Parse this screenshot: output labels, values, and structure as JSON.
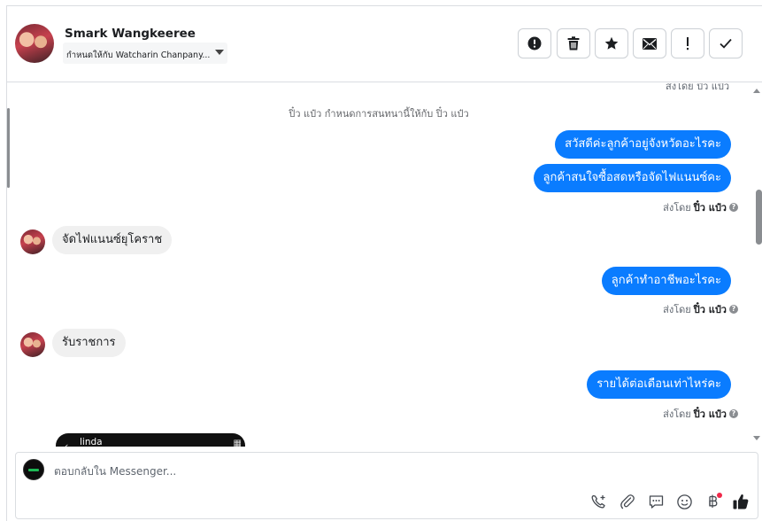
{
  "header": {
    "contact_name": "Smark Wangkeeree",
    "assigned_to": "กำหนดให้กับ Watcharin Chanpany...",
    "actions": [
      {
        "name": "spam-button",
        "icon": "alert-circle-icon"
      },
      {
        "name": "delete-button",
        "icon": "trash-icon"
      },
      {
        "name": "star-button",
        "icon": "star-icon"
      },
      {
        "name": "mark-unread-button",
        "icon": "envelope-icon"
      },
      {
        "name": "follow-up-button",
        "icon": "exclamation-icon"
      },
      {
        "name": "done-button",
        "icon": "checkmark-icon"
      }
    ]
  },
  "conversation": {
    "top_sent_by": "ส่งโดย ปิ๋ว แป๋ว",
    "system_note": "ปิ๋ว แป๋ว กำหนดการสนทนานี้ให้กับ ปิ๋ว แป๋ว",
    "sent_by_prefix": "ส่งโดย",
    "sender_name": "ปิ๋ว แป๋ว",
    "messages": [
      {
        "direction": "out",
        "text": "สวัสดีค่ะลูกค้าอยู่จังหวัดอะไรคะ"
      },
      {
        "direction": "out",
        "text": "ลูกค้าสนใจซื้อสดหรือจัดไฟแนนซ์คะ"
      },
      {
        "direction": "in",
        "text": "จัดไฟแนนซ์ยุโคราช"
      },
      {
        "direction": "out",
        "text": "ลูกค้าทำอาชีพอะไรคะ"
      },
      {
        "direction": "in",
        "text": "รับราชการ"
      },
      {
        "direction": "out",
        "text": "รายได้ต่อเดือนเท่าไหร่คะ"
      }
    ],
    "image_message": {
      "title": "linda"
    }
  },
  "composer": {
    "placeholder": "ตอบกลับใน Messenger...",
    "tools": [
      "phone-add-icon",
      "paperclip-icon",
      "saved-reply-icon",
      "emoji-icon",
      "baht-icon",
      "thumbs-up-icon"
    ]
  },
  "colors": {
    "outgoing_bubble": "#0a7cff",
    "incoming_bubble": "#f0f0f0",
    "notification_dot": "#f02849"
  }
}
